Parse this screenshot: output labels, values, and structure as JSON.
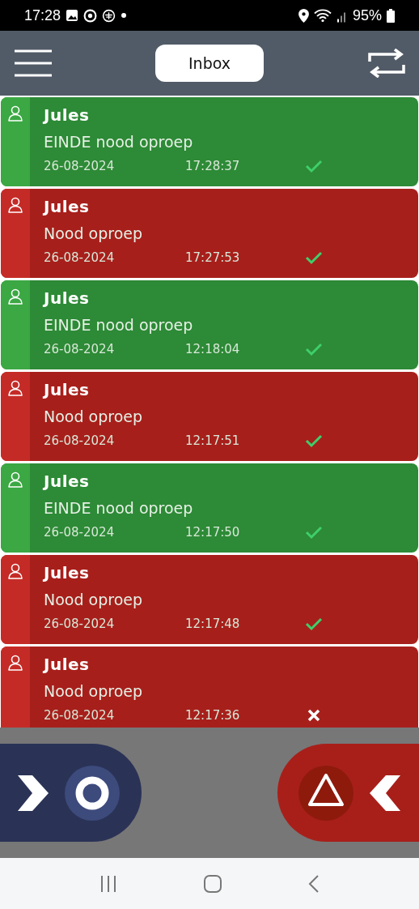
{
  "status_bar": {
    "time": "17:28",
    "battery": "95%"
  },
  "header": {
    "title": "Inbox"
  },
  "messages": [
    {
      "kind": "end",
      "sender": "Jules",
      "text": "EINDE nood oproep",
      "date": "26-08-2024",
      "time": "17:28:37",
      "delivered": true
    },
    {
      "kind": "alarm",
      "sender": "Jules",
      "text": "Nood oproep",
      "date": "26-08-2024",
      "time": "17:27:53",
      "delivered": true
    },
    {
      "kind": "end",
      "sender": "Jules",
      "text": "EINDE nood oproep",
      "date": "26-08-2024",
      "time": "12:18:04",
      "delivered": true
    },
    {
      "kind": "alarm",
      "sender": "Jules",
      "text": "Nood oproep",
      "date": "26-08-2024",
      "time": "12:17:51",
      "delivered": true
    },
    {
      "kind": "end",
      "sender": "Jules",
      "text": "EINDE nood oproep",
      "date": "26-08-2024",
      "time": "12:17:50",
      "delivered": true
    },
    {
      "kind": "alarm",
      "sender": "Jules",
      "text": "Nood oproep",
      "date": "26-08-2024",
      "time": "12:17:48",
      "delivered": true
    },
    {
      "kind": "alarm",
      "sender": "Jules",
      "text": "Nood oproep",
      "date": "26-08-2024",
      "time": "12:17:36",
      "delivered": false
    }
  ]
}
